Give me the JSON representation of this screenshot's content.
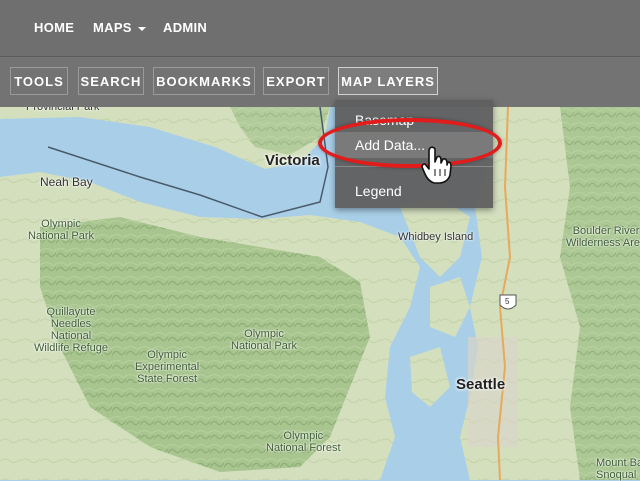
{
  "navbar": {
    "items": [
      {
        "label": "HOME"
      },
      {
        "label": "MAPS"
      },
      {
        "label": "ADMIN"
      }
    ]
  },
  "toolbar": {
    "buttons": [
      {
        "label": "TOOLS"
      },
      {
        "label": "SEARCH"
      },
      {
        "label": "BOOKMARKS"
      },
      {
        "label": "EXPORT"
      },
      {
        "label": "MAP LAYERS"
      }
    ]
  },
  "dropdown": {
    "items": [
      {
        "label": "Basemap"
      },
      {
        "label": "Add Data..."
      },
      {
        "label": "Legend"
      }
    ]
  },
  "map": {
    "labels": {
      "provincial_park": "Provincial Park",
      "victoria": "Victoria",
      "neah_bay": "Neah Bay",
      "olympic_np_west": "Olympic\nNational Park",
      "quillayute": "Quillayute\nNeedles\nNational\nWildlife Refuge",
      "olympic_experimental": "Olympic\nExperimental\nState Forest",
      "olympic_np": "Olympic\nNational Park",
      "olympic_forest": "Olympic\nNational Forest",
      "whidbey": "Whidbey Island",
      "seattle": "Seattle",
      "boulder_river": "Boulder River\nWilderness Area",
      "mount_baker": "Mount Ba\nSnoqual",
      "highway_5": "5"
    }
  },
  "colors": {
    "water": "#a9cfe8",
    "land": "#c9dab0",
    "forest": "#9fbf86",
    "highlight": "#e21b1b"
  }
}
